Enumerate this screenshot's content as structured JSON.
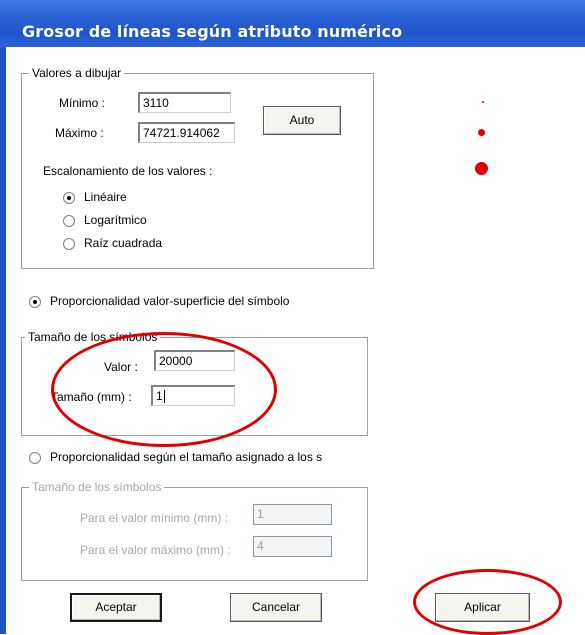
{
  "window": {
    "title": "Grosor de líneas según atributo numérico"
  },
  "values_group": {
    "legend": "Valores a dibujar",
    "min_label": "Mínimo :",
    "min_value": "3110",
    "max_label": "Máximo :",
    "max_value": "74721.914062",
    "auto_button": "Auto",
    "scaling_label": "Escalonamiento de los valores :",
    "scaling_options": [
      {
        "label": "Linéaire",
        "selected": true
      },
      {
        "label": "Logarítmico",
        "selected": false
      },
      {
        "label": "Raíz cuadrada",
        "selected": false
      }
    ]
  },
  "mode1": {
    "label": "Proporcionalidad valor-superficie del símbolo",
    "selected": true
  },
  "size_group1": {
    "legend": "Tamaño de los símbolos",
    "value_label": "Valor :",
    "value": "20000",
    "size_label": "Tamaño (mm) :",
    "size_value": "1"
  },
  "mode2": {
    "label": "Proporcionalidad según el tamaño asignado a los s",
    "selected": false
  },
  "size_group2": {
    "legend": "Tamaño de los símbolos",
    "min_label": "Para el valor mínimo (mm) :",
    "min_value": "1",
    "max_label": "Para el valor máximo (mm) :",
    "max_value": "4"
  },
  "buttons": {
    "ok": "Aceptar",
    "cancel": "Cancelar",
    "apply": "Aplicar"
  },
  "colors": {
    "title_bar": "#2a62d6",
    "highlight": "#e00000",
    "symbol": "#e00000"
  }
}
